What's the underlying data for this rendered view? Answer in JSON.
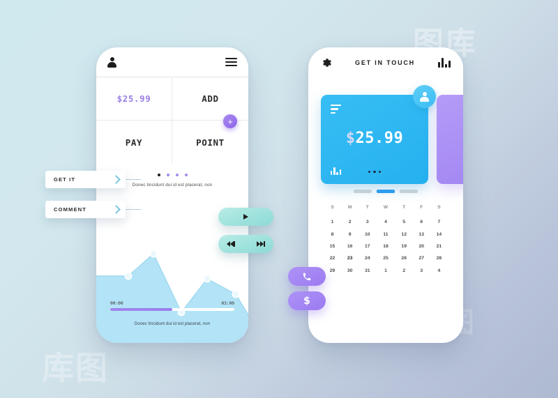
{
  "watermark": {
    "text1": "图库",
    "text2": "图",
    "text3": "库图",
    "text4": "图"
  },
  "left_phone": {
    "topbar": {
      "user_icon": "user-icon",
      "menu_icon": "hamburger-icon"
    },
    "grid": [
      {
        "label": "$25.99",
        "kind": "price"
      },
      {
        "label": "ADD",
        "kind": "action"
      },
      {
        "label": "PAY",
        "kind": "action"
      },
      {
        "label": "POINT",
        "kind": "action"
      }
    ],
    "fab_label": "+",
    "dots": [
      {
        "active": true
      },
      {
        "active": false
      },
      {
        "active": false
      },
      {
        "active": false
      }
    ],
    "caption_top": "Donec tincidunt dui id est placerat, non",
    "caption_bottom": "Donec tincidunt dui id est placerat, non",
    "seek": {
      "start": "00:00",
      "end": "03:00",
      "progress_percent": 50
    },
    "side_buttons": [
      {
        "label": "GET IT"
      },
      {
        "label": "COMMENT"
      }
    ],
    "media": {
      "play_label": "play-icon",
      "rewind_label": "rewind-icon",
      "forward_label": "fast-forward-icon"
    },
    "colors": {
      "accent_purple": "#9b7fe8",
      "chart_fill": "#b3e3f7",
      "chart_stroke": "#8ecfec"
    }
  },
  "right_phone": {
    "topbar": {
      "title": "GET IN TOUCH",
      "left_icon": "gear-icon",
      "right_icon": "bar-chart-icon"
    },
    "blue_card": {
      "amount": "$25.99",
      "amount_symbol": "$",
      "amount_value": "25.99"
    },
    "segments": [
      {
        "active": false
      },
      {
        "active": true
      },
      {
        "active": false
      }
    ],
    "calendar": {
      "weekdays": [
        "S",
        "M",
        "T",
        "W",
        "T",
        "F",
        "S"
      ],
      "weeks": [
        [
          "1",
          "2",
          "3",
          "4",
          "5",
          "6",
          "7"
        ],
        [
          "8",
          "9",
          "10",
          "11",
          "12",
          "13",
          "14"
        ],
        [
          "15",
          "16",
          "17",
          "18",
          "19",
          "20",
          "21"
        ],
        [
          "22",
          "23",
          "24",
          "25",
          "26",
          "27",
          "28"
        ],
        [
          "29",
          "30",
          "31",
          "1",
          "2",
          "3",
          "4"
        ]
      ],
      "selected": "23"
    },
    "action_pills": [
      {
        "icon": "phone-icon"
      },
      {
        "icon": "dollar-icon"
      }
    ],
    "colors": {
      "card_blue": "#2fb8f2",
      "card_purple": "#a387f3",
      "seg_active": "#2f9ef0"
    }
  },
  "chart_data": {
    "type": "area",
    "title": "",
    "x": [
      0,
      1,
      2,
      3,
      4
    ],
    "values": [
      62,
      88,
      22,
      58,
      44
    ],
    "ylim": [
      0,
      100
    ],
    "xlabel": "",
    "ylabel": "",
    "points_visible": 5,
    "fill_color": "#b3e3f7",
    "stroke_color": "#8ecfec"
  }
}
